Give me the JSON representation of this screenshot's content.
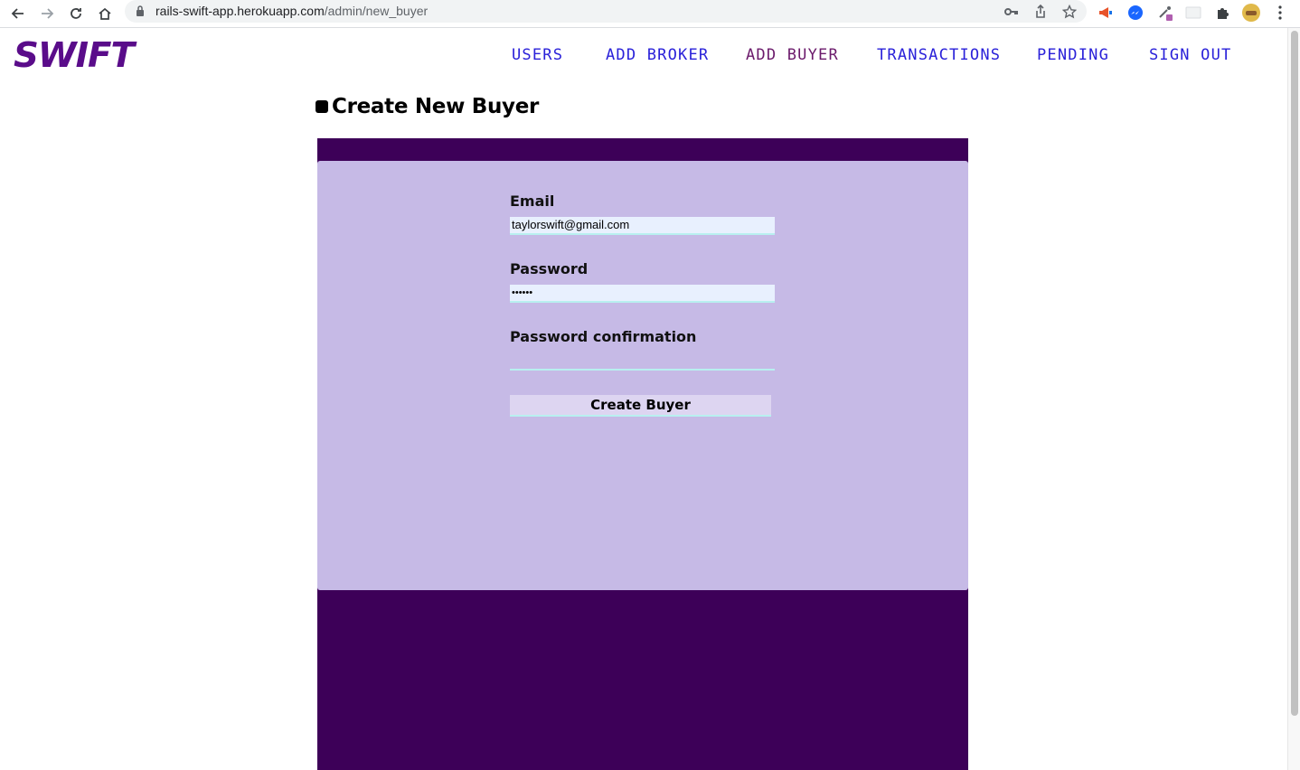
{
  "browser": {
    "url_host": "rails-swift-app.herokuapp.com",
    "url_path": "/admin/new_buyer"
  },
  "logo": {
    "text": "SWIFT",
    "color": "#5a0c8a"
  },
  "nav": {
    "items": [
      "USERS",
      "ADD BROKER",
      "ADD BUYER",
      "TRANSACTIONS",
      "PENDING",
      "SIGN OUT"
    ],
    "active": "ADD BUYER"
  },
  "page": {
    "title": "Create New Buyer"
  },
  "form": {
    "email_label": "Email",
    "email_value": "taylorswift@gmail.com",
    "password_label": "Password",
    "password_value": "••••••",
    "confirmation_label": "Password confirmation",
    "confirmation_value": "",
    "submit_label": "Create Buyer"
  },
  "colors": {
    "outer_panel": "#3d0058",
    "inner_panel": "#c6bae6",
    "nav_link": "#2a21d9",
    "nav_active": "#6b1a6b"
  }
}
